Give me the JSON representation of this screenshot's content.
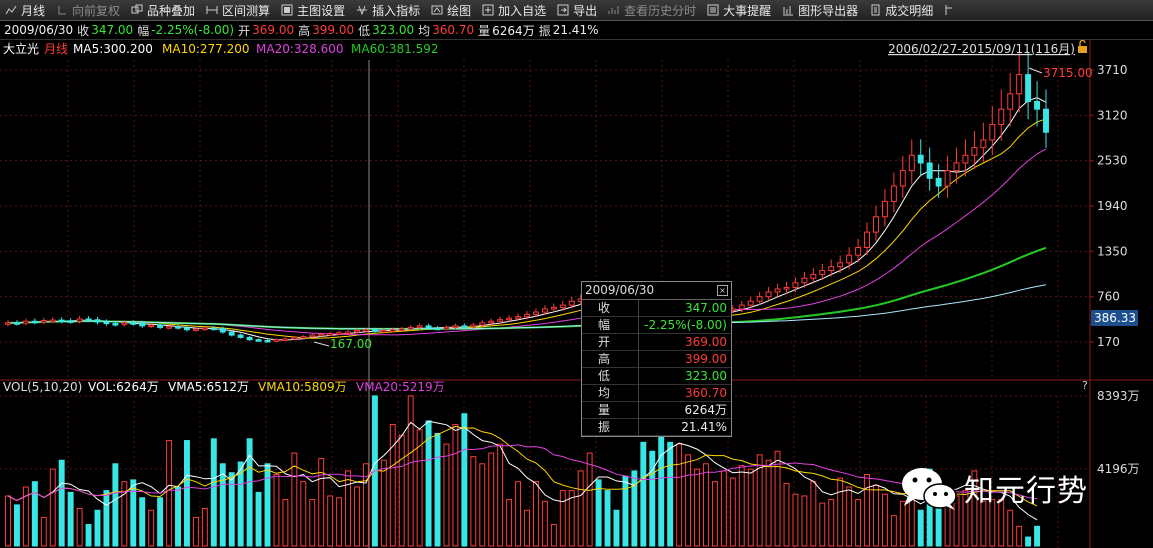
{
  "toolbar": {
    "items": [
      {
        "label": "月线",
        "icon": "chart-wave-icon",
        "disabled": false
      },
      {
        "label": "向前复权",
        "icon": "restore-icon",
        "disabled": true
      },
      {
        "label": "品种叠加",
        "icon": "overlay-icon",
        "disabled": false
      },
      {
        "label": "区间测算",
        "icon": "range-measure-icon",
        "disabled": false
      },
      {
        "label": "主图设置",
        "icon": "settings-icon",
        "disabled": false
      },
      {
        "label": "插入指标",
        "icon": "indicator-icon",
        "disabled": false
      },
      {
        "label": "绘图",
        "icon": "draw-icon",
        "disabled": false
      },
      {
        "label": "加入自选",
        "icon": "add-icon",
        "disabled": false
      },
      {
        "label": "导出",
        "icon": "export-icon",
        "disabled": false
      },
      {
        "label": "查看历史分时",
        "icon": "history-icon",
        "disabled": true
      },
      {
        "label": "大事提醒",
        "icon": "news-icon",
        "disabled": false
      },
      {
        "label": "图形导出器",
        "icon": "bar-export-icon",
        "disabled": false
      },
      {
        "label": "成交明细",
        "icon": "detail-icon",
        "disabled": false
      }
    ]
  },
  "quote": {
    "date": "2009/06/30",
    "close_label": "收",
    "close": "347.00",
    "amp_label": "幅",
    "amp": "-2.25%(-8.00)",
    "open_label": "开",
    "open": "369.00",
    "high_label": "高",
    "high": "399.00",
    "low_label": "低",
    "low": "323.00",
    "avg_label": "均",
    "avg": "360.70",
    "vol_label": "量",
    "vol": "6264万",
    "swing_label": "振",
    "swing": "21.41%"
  },
  "main_chart": {
    "stock": "大立光",
    "period": "月线",
    "ma5": "MA5:300.200",
    "ma10": "MA10:277.200",
    "ma20": "MA20:328.600",
    "ma60": "MA60:381.592",
    "range": "2006/02/27-2015/09/11(116月)",
    "max_label": "3715.00",
    "min_label": "167.00",
    "price_ticks": [
      "3710",
      "3120",
      "2530",
      "1940",
      "1350",
      "760",
      "170"
    ],
    "current_price": "386.33"
  },
  "volume_chart": {
    "vol_title": "VOL(5,10,20)",
    "vol": "VOL:6264万",
    "vma5": "VMA5:6512万",
    "vma10": "VMA10:5809万",
    "vma20": "VMA20:5219万",
    "ticks": [
      "8393万",
      "4196万"
    ],
    "help": "?"
  },
  "tooltip": {
    "date": "2009/06/30",
    "close": "×",
    "rows": [
      {
        "k": "收",
        "v": "347.00",
        "c": "dn"
      },
      {
        "k": "幅",
        "v": "-2.25%(-8.00)",
        "c": "dn"
      },
      {
        "k": "开",
        "v": "369.00",
        "c": "up"
      },
      {
        "k": "高",
        "v": "399.00",
        "c": "up"
      },
      {
        "k": "低",
        "v": "323.00",
        "c": "dn"
      },
      {
        "k": "均",
        "v": "360.70",
        "c": "up"
      },
      {
        "k": "量",
        "v": "6264万",
        "c": "wh"
      },
      {
        "k": "振",
        "v": "21.41%",
        "c": "wh"
      }
    ]
  },
  "watermark": {
    "text": "知元行势"
  },
  "colors": {
    "up": "#ff3b3b",
    "down": "#39e6e6",
    "ma5": "#ffffff",
    "ma10": "#ffd700",
    "ma20": "#e040e0",
    "ma60": "#22cc22",
    "ma_long": "#a8e8ff"
  },
  "chart_data": {
    "type": "candlestick",
    "period": "monthly",
    "x_range": [
      "2006/02",
      "2015/09"
    ],
    "price_axis": [
      170,
      3710
    ],
    "closes": [
      420,
      415,
      440,
      430,
      450,
      455,
      445,
      440,
      470,
      460,
      430,
      410,
      400,
      420,
      415,
      380,
      390,
      360,
      370,
      355,
      330,
      340,
      350,
      345,
      300,
      260,
      230,
      200,
      190,
      180,
      200,
      210,
      230,
      240,
      260,
      270,
      280,
      290,
      300,
      320,
      330,
      310,
      320,
      330,
      340,
      360,
      380,
      350,
      347,
      360,
      380,
      370,
      390,
      420,
      440,
      460,
      480,
      500,
      530,
      560,
      600,
      620,
      650,
      700,
      730,
      800,
      760,
      700,
      650,
      600,
      560,
      520,
      500,
      480,
      460,
      470,
      490,
      510,
      540,
      560,
      590,
      600,
      650,
      700,
      760,
      820,
      860,
      880,
      940,
      1000,
      1050,
      1100,
      1150,
      1200,
      1300,
      1400,
      1600,
      1800,
      2000,
      2200,
      2400,
      2600,
      2500,
      2300,
      2200,
      2400,
      2500,
      2600,
      2700,
      2800,
      3000,
      3200,
      3400,
      3650,
      3300,
      3200,
      2900
    ],
    "volumes": [
      2800,
      2300,
      3300,
      3600,
      1600,
      4300,
      4800,
      3000,
      2100,
      1200,
      2000,
      3100,
      4600,
      3600,
      3700,
      2700,
      2000,
      2700,
      5900,
      3300,
      5900,
      1600,
      2100,
      6000,
      4600,
      4100,
      4700,
      6000,
      3000,
      4600,
      4000,
      2600,
      5200,
      3600,
      2600,
      4900,
      2800,
      2700,
      4200,
      3300,
      4600,
      8400,
      4800,
      6800,
      6200,
      8400,
      6500,
      7000,
      6300,
      5700,
      6800,
      7400,
      5000,
      4600,
      5200,
      5700,
      2600,
      3600,
      2000,
      3600,
      2500,
      1200,
      3100,
      3100,
      4200,
      5200,
      3700,
      3100,
      2000,
      3900,
      4200,
      5800,
      5300,
      6200,
      5800,
      5700,
      5100,
      4300,
      4600,
      3600,
      4200,
      3800,
      4500,
      4300,
      5100,
      4800,
      5300,
      3500,
      2900,
      2800,
      3600,
      2400,
      2600,
      3800,
      3300,
      2600,
      4000,
      3400,
      2900,
      1700,
      2500,
      2700,
      2000,
      4300,
      3500,
      3300,
      2800,
      3100,
      4200,
      2500,
      2600,
      2600,
      2000,
      1100,
      500,
      1100
    ]
  }
}
